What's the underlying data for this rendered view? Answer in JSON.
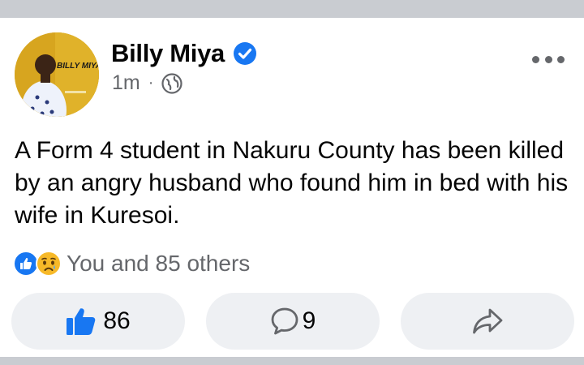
{
  "post": {
    "author": {
      "name": "Billy Miya",
      "avatar_text": "BILLY MIYA",
      "verified": true
    },
    "timestamp": "1m",
    "separator": "·",
    "audience_icon": "globe-icon",
    "more_icon": "more-options-icon",
    "text": "A Form 4 student in Nakuru County has been killed by an angry husband who found him in bed with his wife in Kuresoi.",
    "reactions": {
      "icons": [
        "like-reaction-icon",
        "sad-reaction-icon"
      ],
      "summary": "You and 85 others"
    },
    "actions": {
      "like_count": "86",
      "comment_count": "9",
      "like_icon": "thumbs-up-icon",
      "comment_icon": "comment-bubble-icon",
      "share_icon": "share-arrow-icon"
    }
  },
  "colors": {
    "facebook_blue": "#1877f2",
    "band_gray": "#c9ccd1",
    "button_bg": "#eef0f3",
    "secondary_text": "#65676b",
    "avatar_gold": "#d8a820"
  }
}
